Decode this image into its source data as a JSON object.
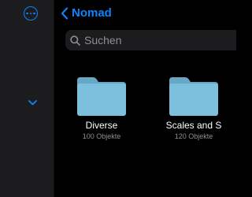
{
  "nav": {
    "back_label": "Nomad"
  },
  "search": {
    "placeholder": "Suchen"
  },
  "folders": [
    {
      "name": "Diverse",
      "meta": "100 Objekte"
    },
    {
      "name": "Scales and S",
      "meta": "120 Objekte"
    }
  ],
  "icons": {
    "more": "ellipsis-circle-icon",
    "sidebar_toggle": "chevron-down-icon",
    "back": "chevron-left-icon",
    "search": "magnifying-glass-icon",
    "folder": "folder-icon"
  },
  "colors": {
    "accent": "#0a84ff",
    "sidebar_bg": "#1c1c1e",
    "main_bg": "#000000",
    "folder_fill": "#7cc0de",
    "folder_tab": "#67a7c4",
    "secondary_text": "#8e8e93"
  }
}
